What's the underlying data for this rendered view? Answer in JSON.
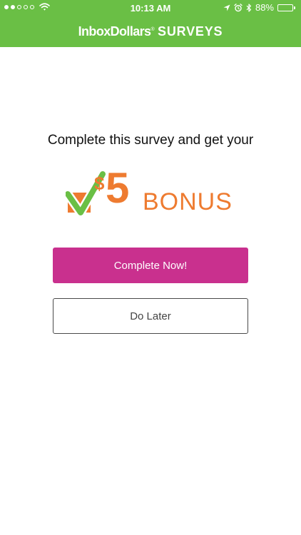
{
  "status_bar": {
    "time": "10:13 AM",
    "battery_percent": "88%",
    "battery_level": 0.88,
    "signal_bars_filled": 2,
    "signal_bars_total": 5,
    "icons": [
      "signal-dots-icon",
      "wifi-icon",
      "location-arrow-icon",
      "alarm-icon",
      "bluetooth-icon",
      "battery-icon"
    ]
  },
  "header": {
    "brand": "InboxDollars",
    "brand_mark": "®",
    "title": "SURVEYS",
    "background_color": "#6abf45"
  },
  "main": {
    "headline": "Complete this survey and get your",
    "bonus": {
      "currency": "$",
      "amount": "5",
      "label": "BONUS",
      "color": "#ee7b30",
      "check_color": "#6abf45"
    },
    "primary_button": {
      "label": "Complete Now!",
      "color": "#c9308e"
    },
    "secondary_button": {
      "label": "Do Later"
    }
  }
}
